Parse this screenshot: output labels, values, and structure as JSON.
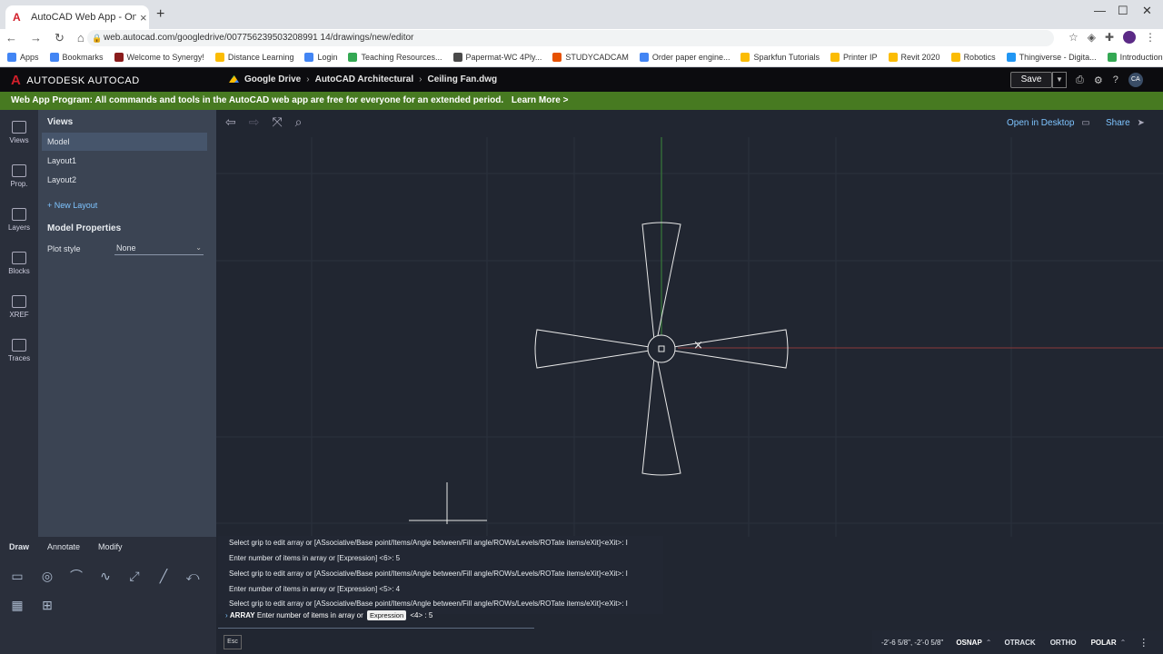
{
  "browser": {
    "tab_title": "AutoCAD Web App - Online CAD",
    "url": "web.autocad.com/googledrive/007756239503208991 14/drawings/new/editor",
    "bookmarks": [
      {
        "label": "Apps",
        "color": "#4285f4"
      },
      {
        "label": "Bookmarks",
        "color": "#4285f4"
      },
      {
        "label": "Welcome to Synergy!",
        "color": "#8a1c1c"
      },
      {
        "label": "Distance Learning",
        "color": "#fbbc04"
      },
      {
        "label": "Login",
        "color": "#4285f4"
      },
      {
        "label": "Teaching Resources...",
        "color": "#34a853"
      },
      {
        "label": "Papermat-WC 4Ply...",
        "color": "#4a4a4a"
      },
      {
        "label": "STUDYCADCAM",
        "color": "#e65100"
      },
      {
        "label": "Order paper engine...",
        "color": "#4285f4"
      },
      {
        "label": "Sparkfun Tutorials",
        "color": "#fbbc04"
      },
      {
        "label": "Printer IP",
        "color": "#fbbc04"
      },
      {
        "label": "Revit 2020",
        "color": "#fbbc04"
      },
      {
        "label": "Robotics",
        "color": "#fbbc04"
      },
      {
        "label": "Thingiverse - Digita...",
        "color": "#2196f3"
      },
      {
        "label": "Introduction to CA...",
        "color": "#34a853"
      }
    ]
  },
  "header": {
    "brand": "AUTODESK AUTOCAD",
    "crumbs": [
      "Google Drive",
      "AutoCAD Architectural",
      "Ceiling Fan.dwg"
    ],
    "save_label": "Save",
    "avatar": "CA"
  },
  "banner": {
    "text": "Web App Program: All commands and tools in the AutoCAD web app are free for everyone for an extended period.",
    "link": "Learn More >"
  },
  "rail": [
    "Views",
    "Prop.",
    "Layers",
    "Blocks",
    "XREF",
    "Traces"
  ],
  "panel": {
    "views_heading": "Views",
    "views": [
      "Model",
      "Layout1",
      "Layout2"
    ],
    "new_layout": "+ New Layout",
    "props_heading": "Model Properties",
    "plot_style_label": "Plot style",
    "plot_style_value": "None"
  },
  "tools": {
    "tabs": [
      "Draw",
      "Annotate",
      "Modify"
    ]
  },
  "canvas_header": {
    "open_desktop": "Open in Desktop",
    "share": "Share"
  },
  "command": {
    "history": [
      "Select grip to edit array or [ASsociative/Base point/Items/Angle between/Fill angle/ROWs/Levels/ROTate items/eXit]<eXit>: I",
      "Enter number of items in array or [Expression] <6>: 5",
      "Select grip to edit array or [ASsociative/Base point/Items/Angle between/Fill angle/ROWs/Levels/ROTate items/eXit]<eXit>: I",
      "Enter number of items in array or [Expression] <5>: 4",
      "Select grip to edit array or [ASsociative/Base point/Items/Angle between/Fill angle/ROWs/Levels/ROTate items/eXit]<eXit>: I"
    ],
    "prompt_cmd": "ARRAY",
    "prompt_text": "Enter number of items in array or",
    "expression_btn": "Expression",
    "prompt_tail": "<4> : 5",
    "esc": "Esc"
  },
  "status": {
    "coords": "-2'-6 5/8\", -2'-0 5/8\"",
    "osnap": "OSNAP",
    "otrack": "OTRACK",
    "ortho": "ORTHO",
    "polar": "POLAR"
  }
}
